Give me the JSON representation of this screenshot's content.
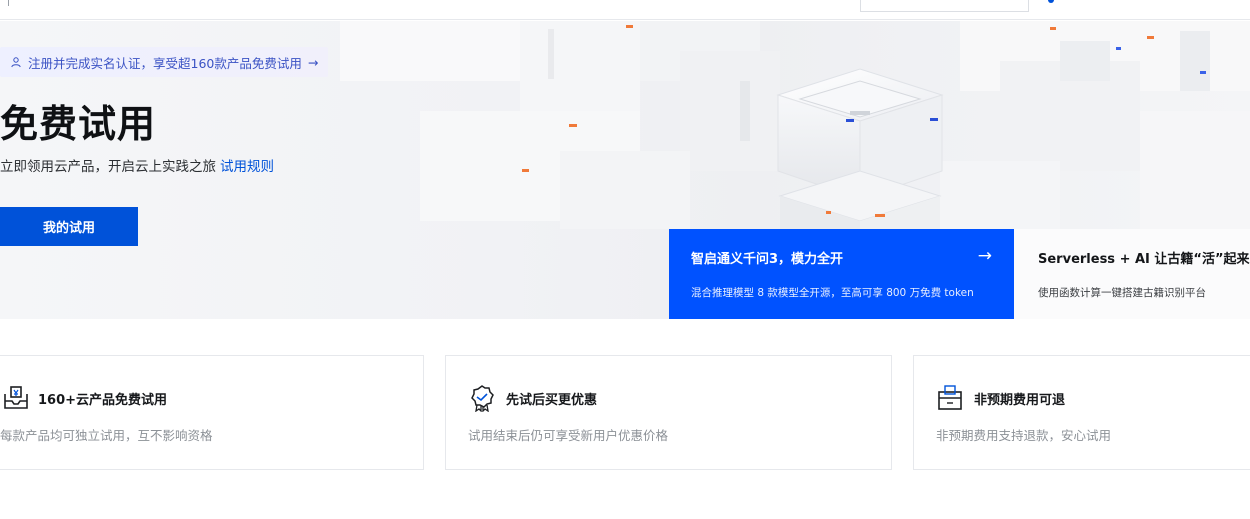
{
  "hero": {
    "promo_text": "注册并完成实名认证，享受超160款产品免费试用",
    "promo_arrow": "→",
    "title": "免费试用",
    "subtitle": "立即领用云产品，开启云上实践之旅",
    "rules_link": "试用规则",
    "my_trial_button": "我的试用"
  },
  "cards": {
    "qwen": {
      "title": "智启通义千问3，模力全开",
      "arrow": "→",
      "desc": "混合推理模型 8 款模型全开源，至高可享 800 万免费 token"
    },
    "serverless": {
      "title": "Serverless + AI 让古籍“活”起来",
      "desc": "使用函数计算一键搭建古籍识别平台"
    }
  },
  "features": [
    {
      "title": "160+云产品免费试用",
      "desc": "每款产品均可独立试用，互不影响资格",
      "icon": "product-box-icon"
    },
    {
      "title": "先试后买更优惠",
      "desc": "试用结束后仍可享受新用户优惠价格",
      "icon": "award-badge-icon"
    },
    {
      "title": "非预期费用可退",
      "desc": "非预期费用支持退款，安心试用",
      "icon": "refund-box-icon"
    }
  ],
  "colors": {
    "brand_blue": "#0052d9",
    "card_blue": "#0052ff",
    "promo_text": "#3a52c4"
  }
}
